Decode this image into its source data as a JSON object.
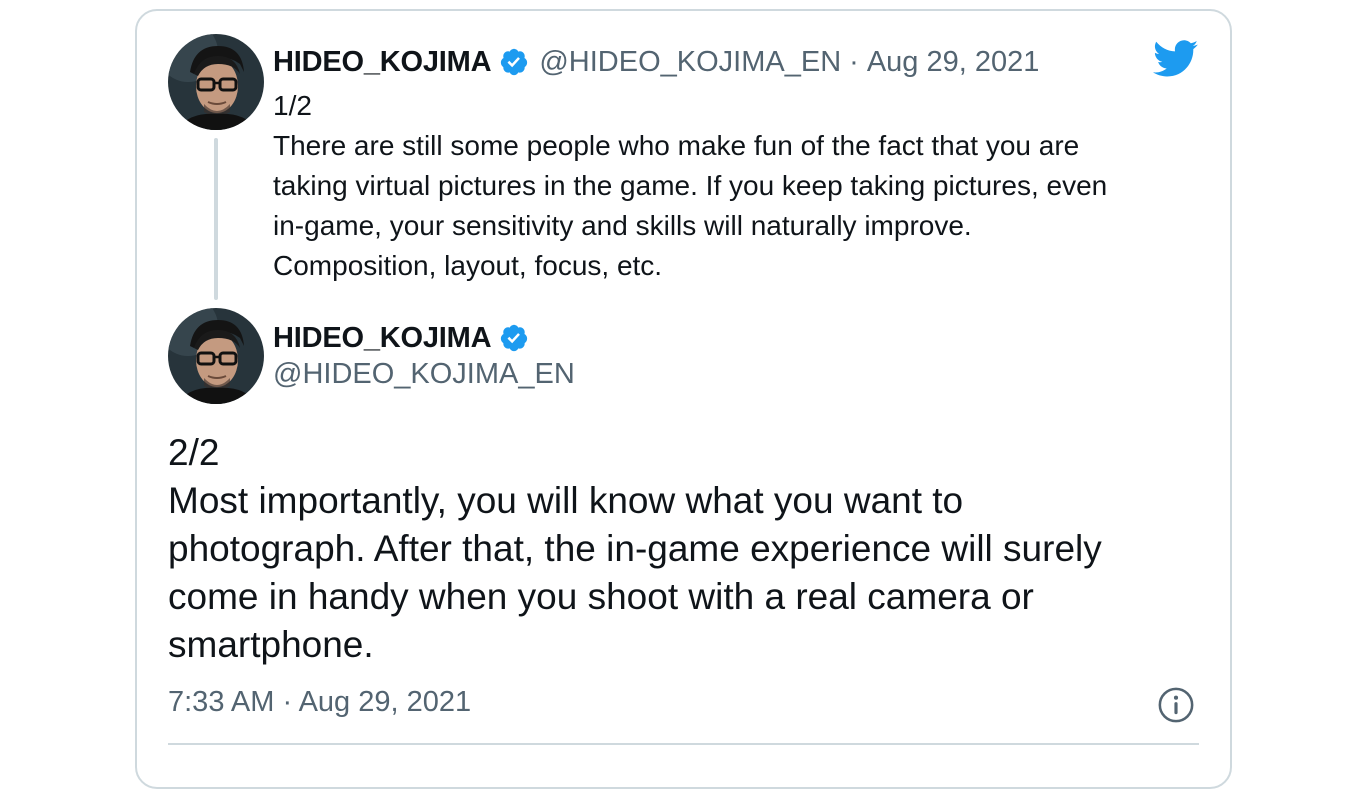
{
  "tweet1": {
    "display_name": "HIDEO_KOJIMA",
    "handle": "@HIDEO_KOJIMA_EN",
    "separator": "·",
    "date": "Aug 29, 2021",
    "lines": [
      "1/2",
      "There are still some people who make fun of the fact that you are",
      "taking virtual pictures in the game. If you keep taking pictures, even",
      "in-game, your sensitivity and skills will naturally improve.",
      "Composition, layout, focus, etc."
    ]
  },
  "tweet2": {
    "display_name": "HIDEO_KOJIMA",
    "handle": "@HIDEO_KOJIMA_EN",
    "lines": [
      "2/2",
      "Most importantly, you will know what you want to",
      "photograph. After that, the in-game experience will surely",
      "come in handy when you shoot with a real camera or",
      "smartphone."
    ],
    "timestamp": "7:33 AM · Aug 29, 2021"
  },
  "icons": {
    "brand": "twitter-bird-icon",
    "verified": "verified-badge-icon",
    "info": "info-icon"
  },
  "colors": {
    "twitter_blue": "#1d9bf0",
    "secondary_text": "#536471",
    "border": "#cfd9de",
    "primary_text": "#0f1419"
  }
}
